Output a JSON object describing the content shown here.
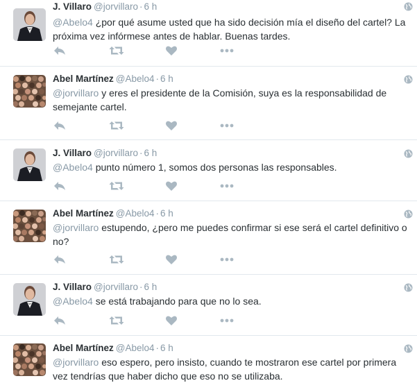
{
  "tweets": [
    {
      "fullname": "J. Villaro",
      "username": "@jorvillaro",
      "sep": "·",
      "time": "6 h",
      "mention": "@Abelo4",
      "text": " ¿por qué asume usted que ha sido decisión mía el diseño del cartel? La próxima vez infórmese antes de hablar. Buenas tardes.",
      "avatar": "person-in-tuxedo"
    },
    {
      "fullname": "Abel Martínez",
      "username": "@Abelo4",
      "sep": "·",
      "time": "6 h",
      "mention": "@jorvillaro",
      "text": " y eres el presidente de la Comisión, suya es la responsabilidad de semejante cartel.",
      "avatar": "crowd"
    },
    {
      "fullname": "J. Villaro",
      "username": "@jorvillaro",
      "sep": "·",
      "time": "6 h",
      "mention": "@Abelo4",
      "text": " punto número 1, somos dos personas las responsables.",
      "avatar": "person-in-tuxedo"
    },
    {
      "fullname": "Abel Martínez",
      "username": "@Abelo4",
      "sep": "·",
      "time": "6 h",
      "mention": "@jorvillaro",
      "text": " estupendo, ¿pero me puedes confirmar si ese será el cartel definitivo o no?",
      "avatar": "crowd"
    },
    {
      "fullname": "J. Villaro",
      "username": "@jorvillaro",
      "sep": "·",
      "time": "6 h",
      "mention": "@Abelo4",
      "text": " se está trabajando para que no lo sea.",
      "avatar": "person-in-tuxedo"
    },
    {
      "fullname": "Abel Martínez",
      "username": "@Abelo4",
      "sep": "·",
      "time": "6 h",
      "mention": "@jorvillaro",
      "text": " eso espero, pero insisto, cuando te mostraron ese cartel por primera vez tendrías que haber dicho que eso no se utilizaba.",
      "avatar": "crowd"
    }
  ],
  "icons": {
    "reply": "reply-icon",
    "retweet": "retweet-icon",
    "like": "heart-icon",
    "more": "more-icon",
    "globe": "globe-icon"
  },
  "colors": {
    "text": "#292f33",
    "muted": "#8899a6",
    "icon": "#aab8c2",
    "divider": "#e1e8ed"
  }
}
